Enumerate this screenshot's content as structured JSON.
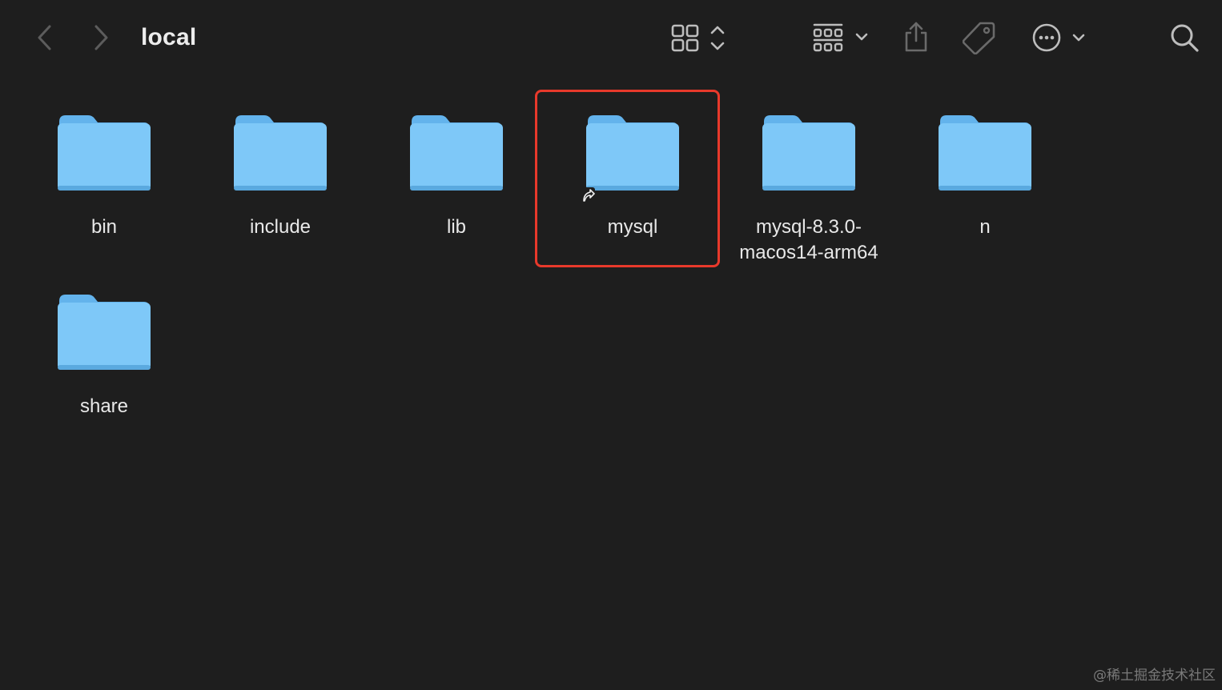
{
  "window": {
    "title": "local"
  },
  "toolbar": {
    "back_icon": "chevron-left-icon",
    "forward_icon": "chevron-right-icon",
    "view_mode_icon": "icon-grid-view-icon",
    "group_icon": "group-by-icon",
    "share_icon": "share-icon",
    "tag_icon": "tag-icon",
    "more_icon": "ellipsis-circle-icon",
    "search_icon": "search-icon"
  },
  "files": [
    {
      "name": "bin",
      "kind": "folder",
      "alias": false
    },
    {
      "name": "include",
      "kind": "folder",
      "alias": false
    },
    {
      "name": "lib",
      "kind": "folder",
      "alias": false
    },
    {
      "name": "mysql",
      "kind": "folder",
      "alias": true,
      "highlighted": true
    },
    {
      "name": "mysql-8.3.0-\nmacos14-arm64",
      "kind": "folder",
      "alias": false
    },
    {
      "name": "n",
      "kind": "folder",
      "alias": false
    },
    {
      "name": "share",
      "kind": "folder",
      "alias": false
    }
  ],
  "colors": {
    "background": "#1e1e1e",
    "folder_body": "#7ec8f8",
    "folder_tab": "#63b3ec",
    "highlight": "#e8392b"
  },
  "watermark": "@稀土掘金技术社区"
}
